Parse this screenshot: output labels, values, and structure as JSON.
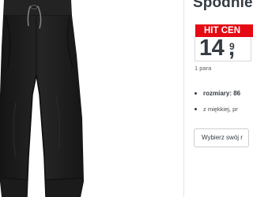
{
  "product": {
    "title": "Spodnie",
    "image_alt": "Czarne spodnie dresowe",
    "badge": "HIT CEN",
    "price_int": "14",
    "price_comma": ",",
    "price_dec": "9",
    "unit": "1 para"
  },
  "bullets": [
    {
      "label": "rozmiary: 86",
      "text": ""
    },
    {
      "label": "",
      "text": "z miękkiej, pr"
    }
  ],
  "size_select": {
    "placeholder": "Wybierz swój r"
  },
  "colors": {
    "badge_bg": "#e60a14",
    "text": "#353b42",
    "fabric": "#1e1e1e"
  }
}
